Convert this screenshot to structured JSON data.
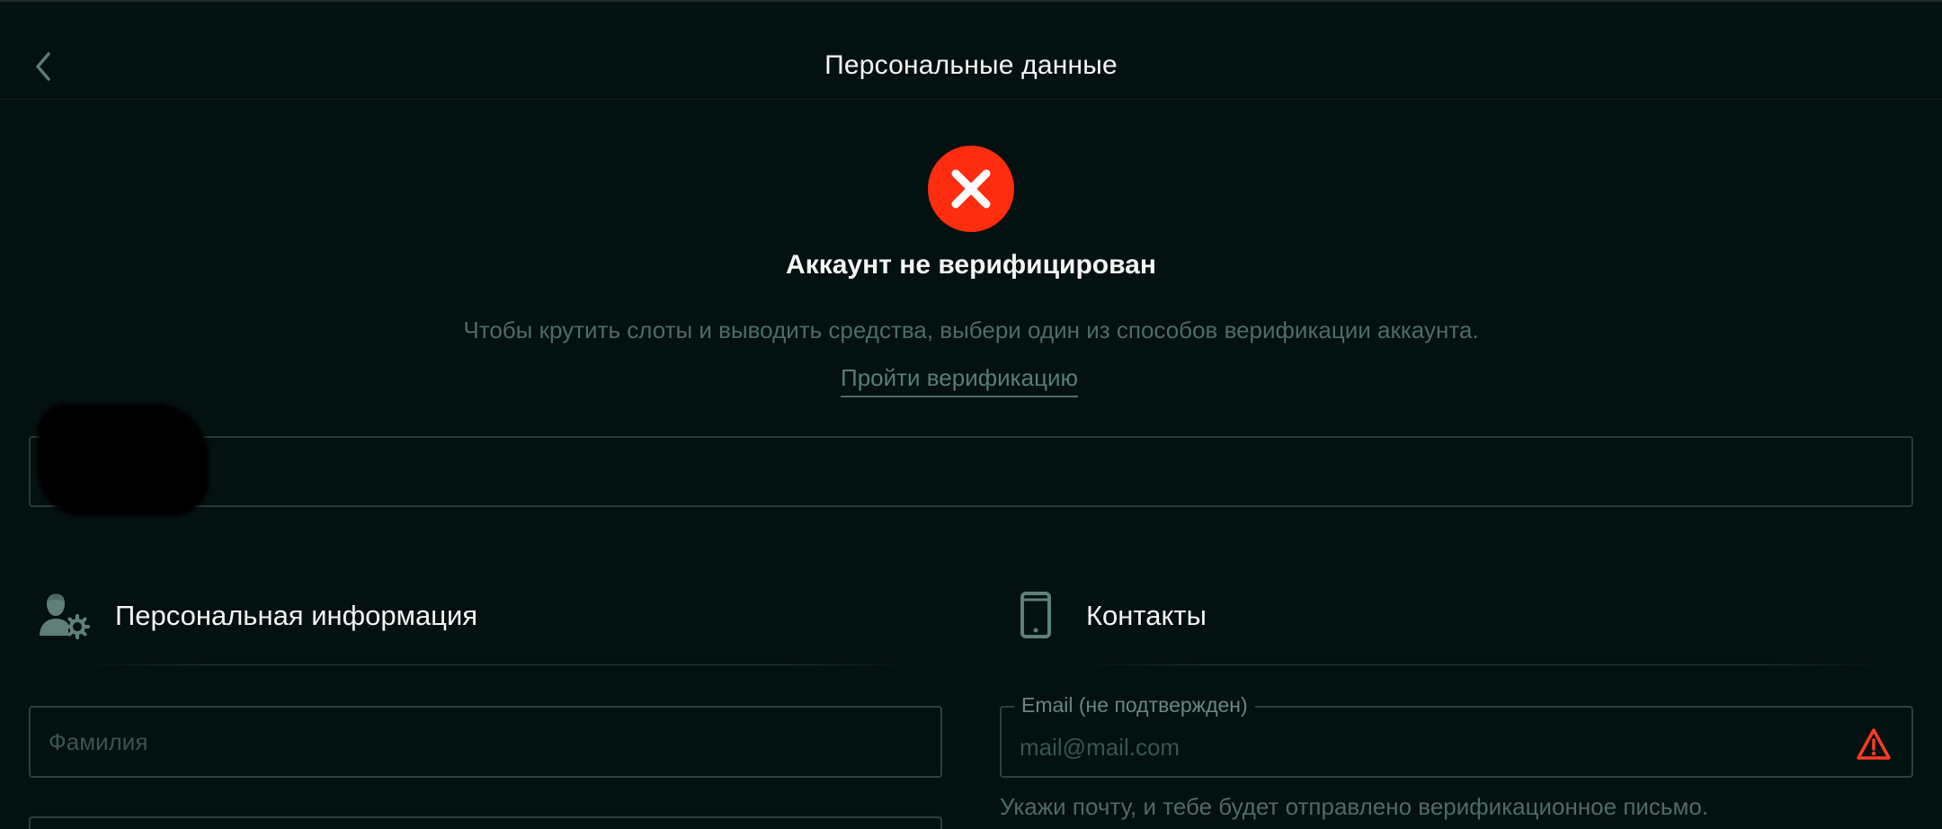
{
  "header": {
    "title": "Персональные данные",
    "back_icon": "chevron-left-icon"
  },
  "verification": {
    "status_icon": "error-x-icon",
    "status_color": "#ff2d0f",
    "title": "Аккаунт не верифицирован",
    "description": "Чтобы крутить слоты и выводить средства, выбери один из способов верификации аккаунта.",
    "link_label": "Пройти верификацию"
  },
  "personal": {
    "icon": "user-settings-icon",
    "title": "Персональная информация",
    "surname_placeholder": "Фамилия"
  },
  "contacts": {
    "icon": "smartphone-icon",
    "title": "Контакты",
    "email_label": "Email (не подтвержден)",
    "email_placeholder": "mail@mail.com",
    "warning_icon": "warning-triangle-icon",
    "warning_color": "#ff3b1f",
    "email_hint": "Укажи почту, и тебе будет отправлено верификационное письмо."
  },
  "colors": {
    "background": "#031110",
    "muted_text": "#4f6b66",
    "border": "#2e403d"
  }
}
